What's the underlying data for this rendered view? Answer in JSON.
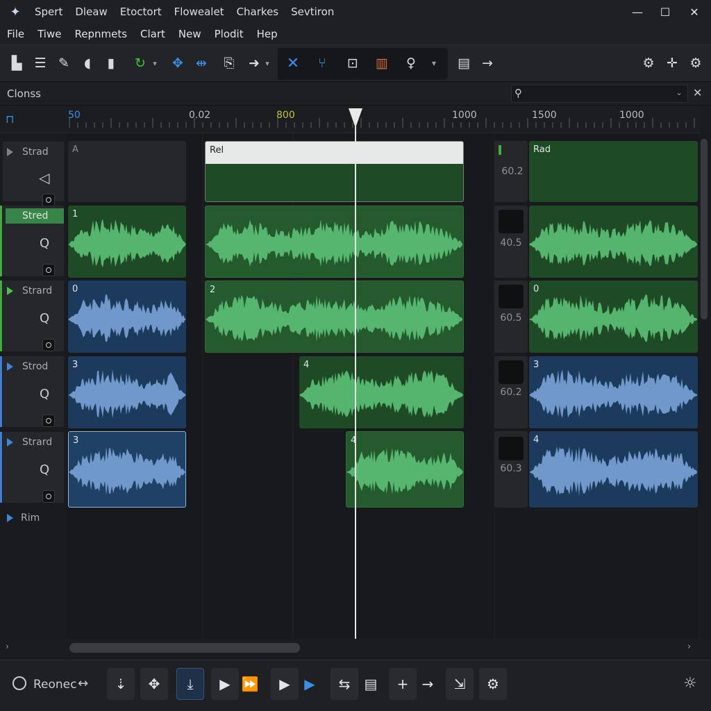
{
  "titlebar": {
    "items": [
      "Spert",
      "Dleaw",
      "Etoctort",
      "Flowealet",
      "Charkes",
      "Sevtiron"
    ],
    "minimize": "—",
    "maximize": "☐",
    "close": "✕"
  },
  "menu": [
    "File",
    "Tiwe",
    "Repnmets",
    "Clart",
    "New",
    "Plodit",
    "Hep"
  ],
  "panel": {
    "title": "Clonss"
  },
  "ruler": {
    "labels": [
      "50",
      "0.02",
      "800",
      "1000",
      "1500",
      "1000"
    ]
  },
  "tracks": [
    {
      "name": "Strad"
    },
    {
      "name": "Stred"
    },
    {
      "name": "Strard"
    },
    {
      "name": "Strod"
    },
    {
      "name": "Strard"
    },
    {
      "name": "Rim"
    }
  ],
  "clips": {
    "t0_a": "A",
    "t0_b": "Rel",
    "t0_c": "Rad",
    "t1_a": "1",
    "t2_a": "0",
    "t2_b": "2",
    "t2_c": "0",
    "t3_a": "3",
    "t3_b": "4",
    "t3_c": "3",
    "t4_a": "3",
    "t4_b": "4",
    "t4_c": "4"
  },
  "values": [
    "60.2",
    "40.5",
    "60.5",
    "60.2",
    "60.3"
  ],
  "transport": {
    "label": "Reonec"
  },
  "colors": {
    "green_clip": "#1f4a26",
    "blue_clip": "#1c3b5c",
    "wave_green": "#5fc77a",
    "wave_blue": "#7fa9dd",
    "accent_green": "#44c13b",
    "accent_blue": "#3c8fe6"
  }
}
